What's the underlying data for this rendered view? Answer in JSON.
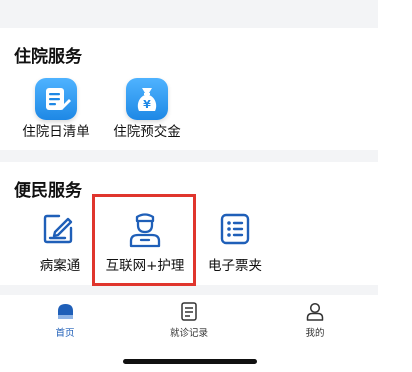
{
  "inpatient": {
    "title": "住院服务",
    "items": [
      {
        "label": "住院日清单",
        "icon": "daily-list-icon"
      },
      {
        "label": "住院预交金",
        "icon": "money-bag-yen-icon"
      }
    ]
  },
  "convenience": {
    "title": "便民服务",
    "items": [
      {
        "label": "病案通",
        "icon": "edit-document-icon"
      },
      {
        "label": "互联网+护理",
        "icon": "nurse-icon"
      },
      {
        "label": "电子票夹",
        "icon": "list-icon"
      }
    ]
  },
  "tabs": [
    {
      "label": "首页",
      "icon": "home-icon",
      "active": true
    },
    {
      "label": "就诊记录",
      "icon": "record-icon",
      "active": false
    },
    {
      "label": "我的",
      "icon": "profile-icon",
      "active": false
    }
  ],
  "colors": {
    "accent": "#1f5fb8",
    "tile": "#1e88e5",
    "highlight": "#e0352d",
    "separator": "#f3f4f6"
  }
}
